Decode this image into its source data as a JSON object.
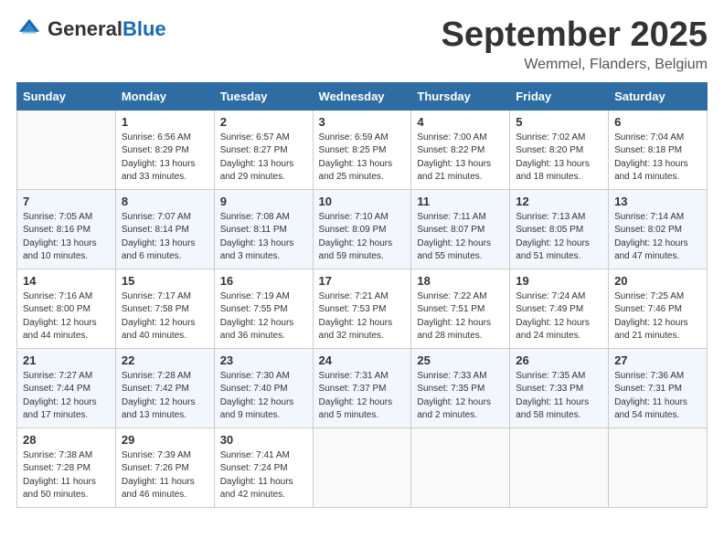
{
  "logo": {
    "general": "General",
    "blue": "Blue"
  },
  "title": "September 2025",
  "location": "Wemmel, Flanders, Belgium",
  "weekdays": [
    "Sunday",
    "Monday",
    "Tuesday",
    "Wednesday",
    "Thursday",
    "Friday",
    "Saturday"
  ],
  "weeks": [
    [
      {
        "day": "",
        "sunrise": "",
        "sunset": "",
        "daylight": ""
      },
      {
        "day": "1",
        "sunrise": "Sunrise: 6:56 AM",
        "sunset": "Sunset: 8:29 PM",
        "daylight": "Daylight: 13 hours and 33 minutes."
      },
      {
        "day": "2",
        "sunrise": "Sunrise: 6:57 AM",
        "sunset": "Sunset: 8:27 PM",
        "daylight": "Daylight: 13 hours and 29 minutes."
      },
      {
        "day": "3",
        "sunrise": "Sunrise: 6:59 AM",
        "sunset": "Sunset: 8:25 PM",
        "daylight": "Daylight: 13 hours and 25 minutes."
      },
      {
        "day": "4",
        "sunrise": "Sunrise: 7:00 AM",
        "sunset": "Sunset: 8:22 PM",
        "daylight": "Daylight: 13 hours and 21 minutes."
      },
      {
        "day": "5",
        "sunrise": "Sunrise: 7:02 AM",
        "sunset": "Sunset: 8:20 PM",
        "daylight": "Daylight: 13 hours and 18 minutes."
      },
      {
        "day": "6",
        "sunrise": "Sunrise: 7:04 AM",
        "sunset": "Sunset: 8:18 PM",
        "daylight": "Daylight: 13 hours and 14 minutes."
      }
    ],
    [
      {
        "day": "7",
        "sunrise": "Sunrise: 7:05 AM",
        "sunset": "Sunset: 8:16 PM",
        "daylight": "Daylight: 13 hours and 10 minutes."
      },
      {
        "day": "8",
        "sunrise": "Sunrise: 7:07 AM",
        "sunset": "Sunset: 8:14 PM",
        "daylight": "Daylight: 13 hours and 6 minutes."
      },
      {
        "day": "9",
        "sunrise": "Sunrise: 7:08 AM",
        "sunset": "Sunset: 8:11 PM",
        "daylight": "Daylight: 13 hours and 3 minutes."
      },
      {
        "day": "10",
        "sunrise": "Sunrise: 7:10 AM",
        "sunset": "Sunset: 8:09 PM",
        "daylight": "Daylight: 12 hours and 59 minutes."
      },
      {
        "day": "11",
        "sunrise": "Sunrise: 7:11 AM",
        "sunset": "Sunset: 8:07 PM",
        "daylight": "Daylight: 12 hours and 55 minutes."
      },
      {
        "day": "12",
        "sunrise": "Sunrise: 7:13 AM",
        "sunset": "Sunset: 8:05 PM",
        "daylight": "Daylight: 12 hours and 51 minutes."
      },
      {
        "day": "13",
        "sunrise": "Sunrise: 7:14 AM",
        "sunset": "Sunset: 8:02 PM",
        "daylight": "Daylight: 12 hours and 47 minutes."
      }
    ],
    [
      {
        "day": "14",
        "sunrise": "Sunrise: 7:16 AM",
        "sunset": "Sunset: 8:00 PM",
        "daylight": "Daylight: 12 hours and 44 minutes."
      },
      {
        "day": "15",
        "sunrise": "Sunrise: 7:17 AM",
        "sunset": "Sunset: 7:58 PM",
        "daylight": "Daylight: 12 hours and 40 minutes."
      },
      {
        "day": "16",
        "sunrise": "Sunrise: 7:19 AM",
        "sunset": "Sunset: 7:55 PM",
        "daylight": "Daylight: 12 hours and 36 minutes."
      },
      {
        "day": "17",
        "sunrise": "Sunrise: 7:21 AM",
        "sunset": "Sunset: 7:53 PM",
        "daylight": "Daylight: 12 hours and 32 minutes."
      },
      {
        "day": "18",
        "sunrise": "Sunrise: 7:22 AM",
        "sunset": "Sunset: 7:51 PM",
        "daylight": "Daylight: 12 hours and 28 minutes."
      },
      {
        "day": "19",
        "sunrise": "Sunrise: 7:24 AM",
        "sunset": "Sunset: 7:49 PM",
        "daylight": "Daylight: 12 hours and 24 minutes."
      },
      {
        "day": "20",
        "sunrise": "Sunrise: 7:25 AM",
        "sunset": "Sunset: 7:46 PM",
        "daylight": "Daylight: 12 hours and 21 minutes."
      }
    ],
    [
      {
        "day": "21",
        "sunrise": "Sunrise: 7:27 AM",
        "sunset": "Sunset: 7:44 PM",
        "daylight": "Daylight: 12 hours and 17 minutes."
      },
      {
        "day": "22",
        "sunrise": "Sunrise: 7:28 AM",
        "sunset": "Sunset: 7:42 PM",
        "daylight": "Daylight: 12 hours and 13 minutes."
      },
      {
        "day": "23",
        "sunrise": "Sunrise: 7:30 AM",
        "sunset": "Sunset: 7:40 PM",
        "daylight": "Daylight: 12 hours and 9 minutes."
      },
      {
        "day": "24",
        "sunrise": "Sunrise: 7:31 AM",
        "sunset": "Sunset: 7:37 PM",
        "daylight": "Daylight: 12 hours and 5 minutes."
      },
      {
        "day": "25",
        "sunrise": "Sunrise: 7:33 AM",
        "sunset": "Sunset: 7:35 PM",
        "daylight": "Daylight: 12 hours and 2 minutes."
      },
      {
        "day": "26",
        "sunrise": "Sunrise: 7:35 AM",
        "sunset": "Sunset: 7:33 PM",
        "daylight": "Daylight: 11 hours and 58 minutes."
      },
      {
        "day": "27",
        "sunrise": "Sunrise: 7:36 AM",
        "sunset": "Sunset: 7:31 PM",
        "daylight": "Daylight: 11 hours and 54 minutes."
      }
    ],
    [
      {
        "day": "28",
        "sunrise": "Sunrise: 7:38 AM",
        "sunset": "Sunset: 7:28 PM",
        "daylight": "Daylight: 11 hours and 50 minutes."
      },
      {
        "day": "29",
        "sunrise": "Sunrise: 7:39 AM",
        "sunset": "Sunset: 7:26 PM",
        "daylight": "Daylight: 11 hours and 46 minutes."
      },
      {
        "day": "30",
        "sunrise": "Sunrise: 7:41 AM",
        "sunset": "Sunset: 7:24 PM",
        "daylight": "Daylight: 11 hours and 42 minutes."
      },
      {
        "day": "",
        "sunrise": "",
        "sunset": "",
        "daylight": ""
      },
      {
        "day": "",
        "sunrise": "",
        "sunset": "",
        "daylight": ""
      },
      {
        "day": "",
        "sunrise": "",
        "sunset": "",
        "daylight": ""
      },
      {
        "day": "",
        "sunrise": "",
        "sunset": "",
        "daylight": ""
      }
    ]
  ]
}
